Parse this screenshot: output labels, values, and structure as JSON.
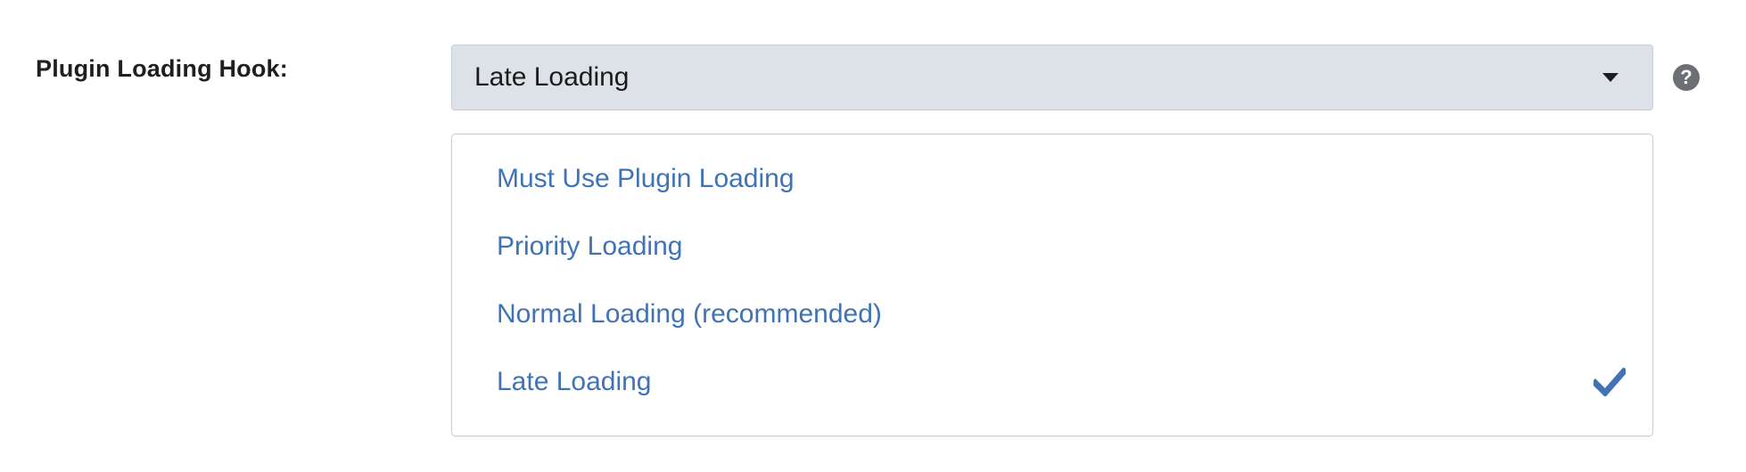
{
  "field": {
    "label": "Plugin Loading Hook:"
  },
  "select": {
    "value": "Late Loading",
    "caret_icon": "caret-down-icon"
  },
  "help": {
    "icon": "question-circle-icon",
    "glyph": "?"
  },
  "dropdown": {
    "options": [
      {
        "label": "Must Use Plugin Loading",
        "selected": false
      },
      {
        "label": "Priority Loading",
        "selected": false
      },
      {
        "label": "Normal Loading (recommended)",
        "selected": false
      },
      {
        "label": "Late Loading",
        "selected": true
      }
    ],
    "check_icon": "checkmark-icon"
  },
  "colors": {
    "option_text": "#3f73b5",
    "select_bg": "#dde2e9",
    "help_icon_bg": "#6c6f73",
    "check": "#3f73b5"
  }
}
